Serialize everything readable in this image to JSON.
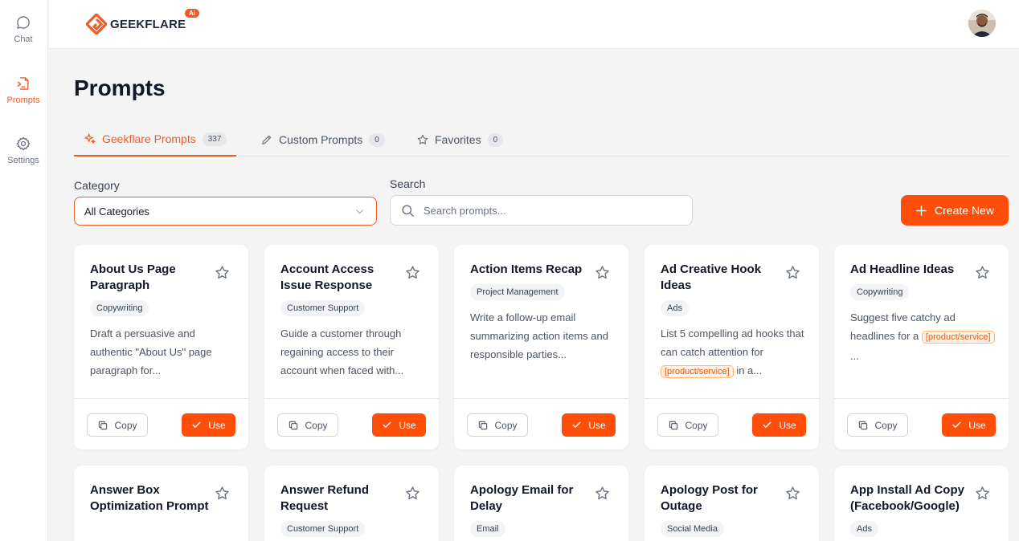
{
  "brand": {
    "name": "GEEKFLARE",
    "badge": "Ai",
    "accent": "#f15a22"
  },
  "sidebar": {
    "items": [
      {
        "label": "Chat",
        "icon": "chat-bubble-icon",
        "active": false
      },
      {
        "label": "Prompts",
        "icon": "prompt-document-icon",
        "active": true
      },
      {
        "label": "Settings",
        "icon": "gear-icon",
        "active": false
      }
    ]
  },
  "page": {
    "title": "Prompts"
  },
  "tabs": [
    {
      "label": "Geekflare Prompts",
      "count": "337",
      "icon": "sparkle-icon",
      "active": true
    },
    {
      "label": "Custom Prompts",
      "count": "0",
      "icon": "pencil-icon",
      "active": false
    },
    {
      "label": "Favorites",
      "count": "0",
      "icon": "star-icon",
      "active": false
    }
  ],
  "filters": {
    "category_label": "Category",
    "category_value": "All Categories",
    "search_label": "Search",
    "search_placeholder": "Search prompts...",
    "search_value": ""
  },
  "create_button": {
    "label": "Create New"
  },
  "card_actions": {
    "copy_label": "Copy",
    "use_label": "Use"
  },
  "cards": [
    {
      "title": "About Us Page Paragraph",
      "tag": "Copywriting",
      "desc": "Draft a persuasive and authentic \"About Us\" page paragraph for..."
    },
    {
      "title": "Account Access Issue Response",
      "tag": "Customer Support",
      "desc": "Guide a customer through regaining access to their account when faced with..."
    },
    {
      "title": "Action Items Recap",
      "tag": "Project Management",
      "desc": "Write a follow-up email summarizing action items and responsible parties..."
    },
    {
      "title": "Ad Creative Hook Ideas",
      "tag": "Ads",
      "desc_before": "List 5 compelling ad hooks that can catch attention for ",
      "placeholder": "[product/service]",
      "desc_after": " in a..."
    },
    {
      "title": "Ad Headline Ideas",
      "tag": "Copywriting",
      "desc_before": "Suggest five catchy ad headlines for a ",
      "placeholder": "[product/service]",
      "desc_after": " ..."
    },
    {
      "title": "Answer Box Optimization Prompt",
      "tag": ""
    },
    {
      "title": "Answer Refund Request",
      "tag": "Customer Support"
    },
    {
      "title": "Apology Email for Delay",
      "tag": "Email"
    },
    {
      "title": "Apology Post for Outage",
      "tag": "Social Media"
    },
    {
      "title": "App Install Ad Copy (Facebook/Google)",
      "tag": "Ads"
    }
  ]
}
